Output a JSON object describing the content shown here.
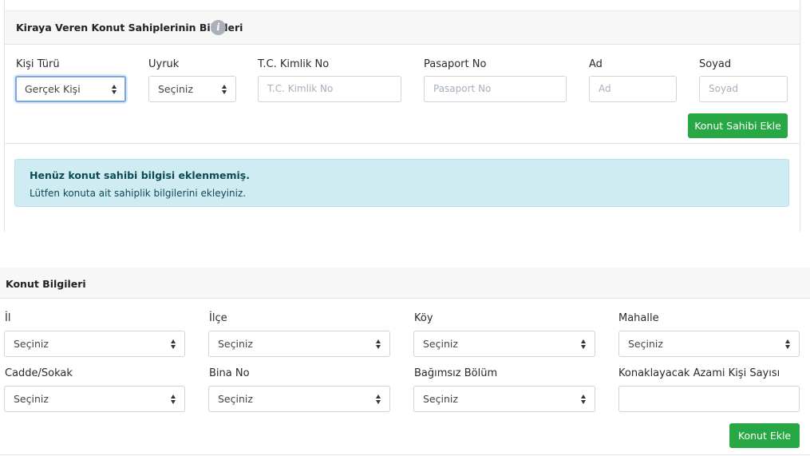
{
  "owners": {
    "title": "Kiraya Veren Konut Sahiplerinin Bilgileri",
    "info_icon": "info-icon",
    "fields": {
      "person_type": {
        "label": "Kişi Türü",
        "value": "Gerçek Kişi"
      },
      "nationality": {
        "label": "Uyruk",
        "value": "Seçiniz"
      },
      "tc_no": {
        "label": "T.C. Kimlik No",
        "placeholder": "T.C. Kimlik No"
      },
      "passport_no": {
        "label": "Pasaport No",
        "placeholder": "Pasaport No"
      },
      "first_name": {
        "label": "Ad",
        "placeholder": "Ad"
      },
      "last_name": {
        "label": "Soyad",
        "placeholder": "Soyad"
      }
    },
    "add_button": "Konut Sahibi Ekle",
    "alert": {
      "title": "Henüz konut sahibi bilgisi eklenmemiş.",
      "text": "Lütfen konuta ait sahiplik bilgilerini ekleyiniz."
    }
  },
  "housing": {
    "title": "Konut Bilgileri",
    "fields": {
      "il": {
        "label": "İl",
        "value": "Seçiniz"
      },
      "ilce": {
        "label": "İlçe",
        "value": "Seçiniz"
      },
      "koy": {
        "label": "Köy",
        "value": "Seçiniz"
      },
      "mahalle": {
        "label": "Mahalle",
        "value": "Seçiniz"
      },
      "cadde": {
        "label": "Cadde/Sokak",
        "value": "Seçiniz"
      },
      "bina_no": {
        "label": "Bina No",
        "value": "Seçiniz"
      },
      "bagimsiz_bolum": {
        "label": "Bağımsız Bölüm",
        "value": "Seçiniz"
      },
      "azami_kisi": {
        "label": "Konaklayacak Azami Kişi Sayısı",
        "value": ""
      }
    },
    "add_button": "Konut Ekle"
  },
  "colors": {
    "success": "#28a745",
    "info_bg": "#cfecf2",
    "focus_border": "#7aa7e0"
  }
}
